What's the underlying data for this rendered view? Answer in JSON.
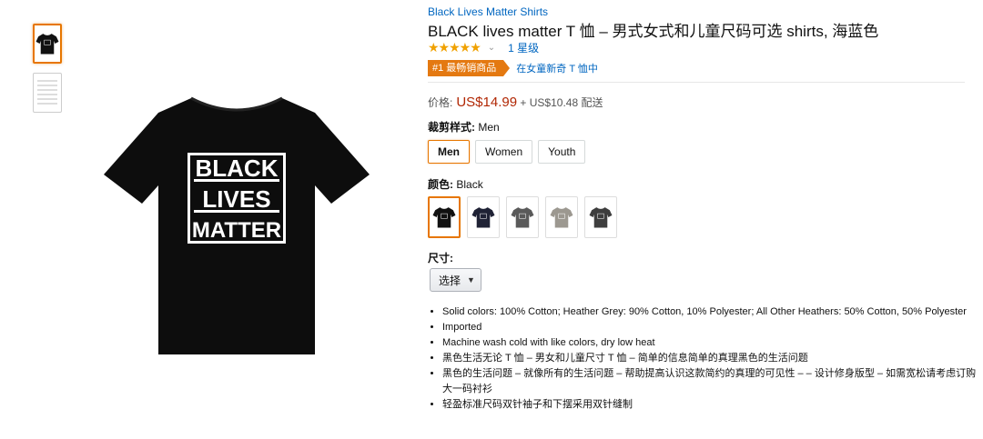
{
  "product": {
    "byline": "Black Lives Matter Shirts",
    "title": "BLACK lives matter T 恤 – 男式女式和儿童尺码可选 shirts, 海蓝色",
    "rating_count": "1 星级",
    "stars": "★★★★★",
    "badge": "#1 最畅销商品",
    "badge_category": "在女童新奇 T 恤中",
    "price_label": "价格:",
    "price": "US$14.99",
    "shipping": "+ US$10.48 配送",
    "image_print": [
      "BLACK",
      "LIVES",
      "MATTER"
    ]
  },
  "fit": {
    "label": "裁剪样式:",
    "selected": "Men",
    "options": [
      "Men",
      "Women",
      "Youth"
    ]
  },
  "color": {
    "label": "颜色:",
    "selected": "Black",
    "swatches": [
      "#111111",
      "#1f2235",
      "#5a5a5a",
      "#9c9890",
      "#3e3e3e"
    ]
  },
  "size": {
    "label": "尺寸:",
    "select_value": "选择"
  },
  "bullets": [
    "Solid colors: 100% Cotton; Heather Grey: 90% Cotton, 10% Polyester; All Other Heathers: 50% Cotton, 50% Polyester",
    "Imported",
    "Machine wash cold with like colors, dry low heat",
    "黑色生活无论 T 恤 – 男女和儿童尺寸 T 恤 – 简单的信息简单的真理黑色的生活问题",
    "黑色的生活问题 – 就像所有的生活问题 – 帮助提高认识这款简约的真理的可见性 – – 设计修身版型 – 如需宽松请考虑订购大一码衬衫",
    "轻盈标准尺码双针袖子和下摆采用双针缝制"
  ]
}
